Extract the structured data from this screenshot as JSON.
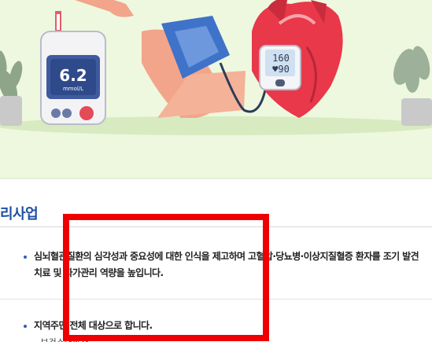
{
  "banner": {
    "glucose_meter": {
      "reading": "6.2",
      "unit": "mmol/L"
    },
    "bp_monitor": {
      "systolic": "160",
      "diastolic": "♥90"
    }
  },
  "section": {
    "title": "리사업",
    "items": [
      {
        "lines": [
          "심뇌혈관질환의 심각성과 중요성에 대한 인식을 제고하며 고혈압·당뇨병·이상지질혈증 환자를 조기 발견",
          "치료 및 자가관리 역량을 높입니다."
        ]
      },
      {
        "lines": [
          "지역주민 전체 대상으로 합니다."
        ],
        "sub": "- 보건소대상자"
      }
    ]
  },
  "colors": {
    "banner_bg": "#edf8df",
    "title": "#1f4fa3",
    "bullet": "#2b5fb6",
    "highlight": "#ee0000"
  }
}
